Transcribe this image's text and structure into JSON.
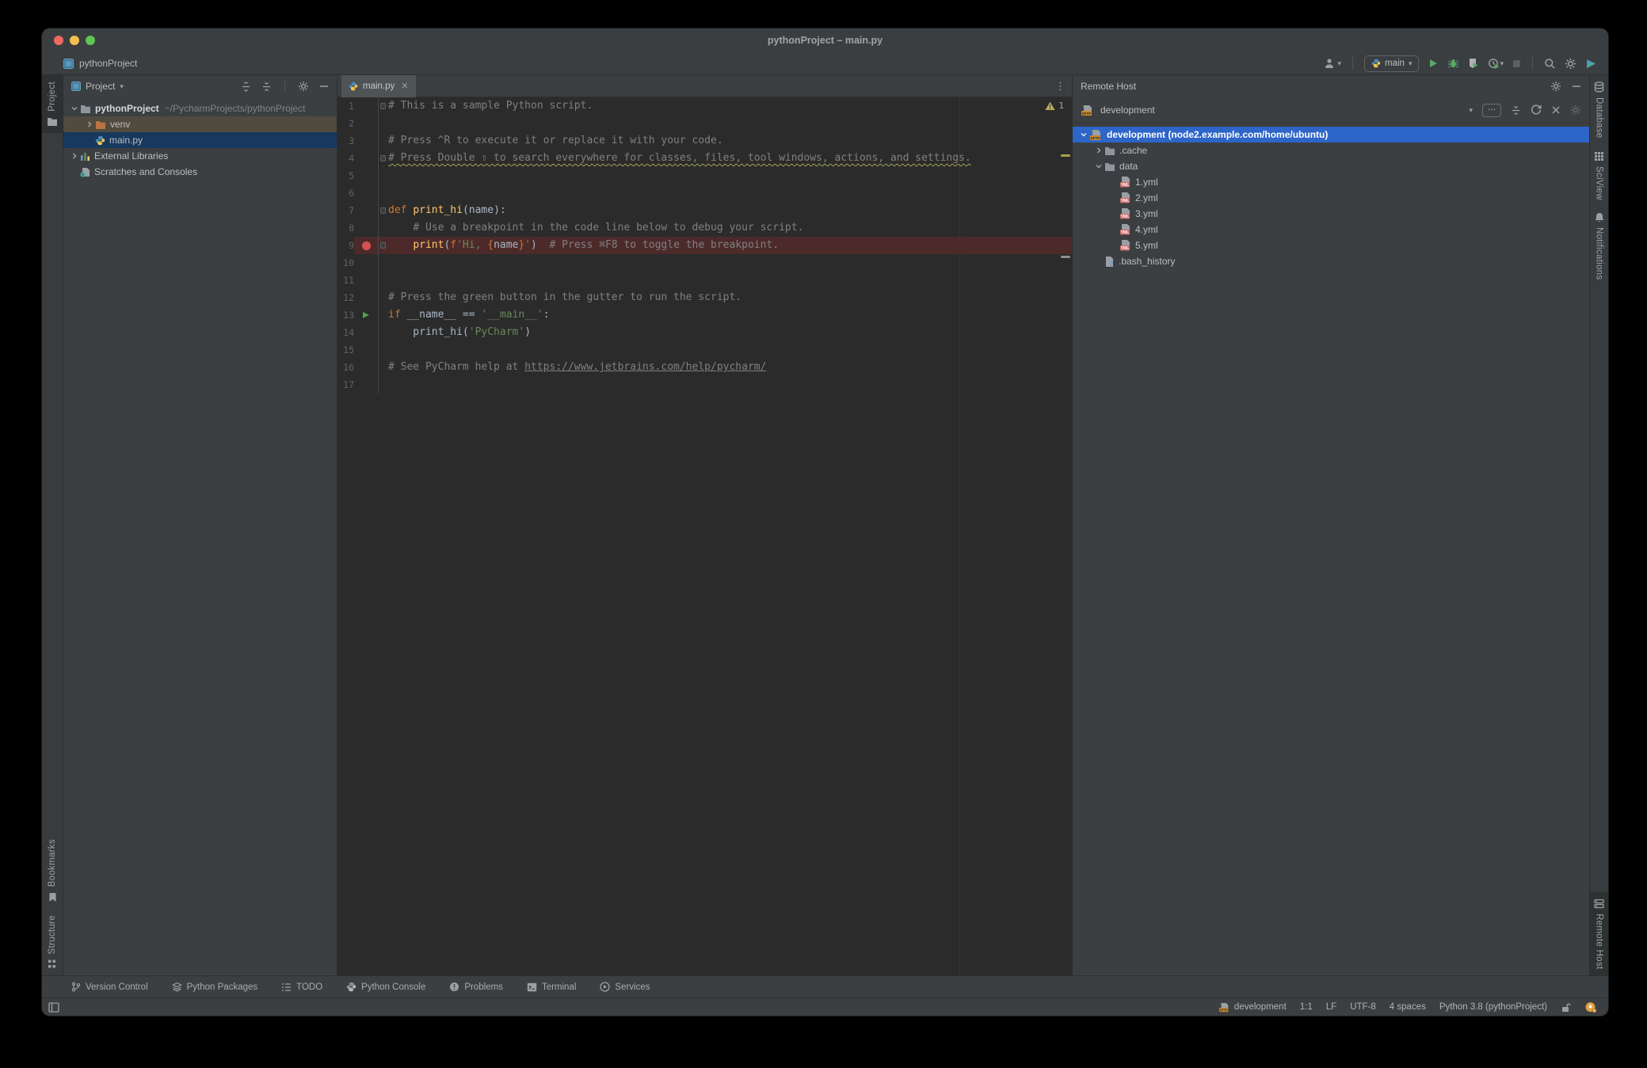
{
  "window": {
    "title": "pythonProject – main.py"
  },
  "header": {
    "breadcrumb": "pythonProject",
    "run_config": "main"
  },
  "activity_bars": {
    "left_top": [
      {
        "id": "project",
        "label": "Project",
        "icon": "tool-folder",
        "active": true
      }
    ],
    "left_bottom": [
      {
        "id": "bookmarks",
        "label": "Bookmarks",
        "icon": "bookmark"
      },
      {
        "id": "structure",
        "label": "Structure",
        "icon": "structure"
      }
    ],
    "right_top": [
      {
        "id": "database",
        "label": "Database",
        "icon": "database"
      },
      {
        "id": "sciview",
        "label": "SciView",
        "icon": "sciview"
      },
      {
        "id": "notifications",
        "label": "Notifications",
        "icon": "bell"
      }
    ],
    "right_bottom": [
      {
        "id": "remote-host",
        "label": "Remote Host",
        "icon": "server",
        "active": true
      }
    ]
  },
  "project_panel": {
    "title": "Project",
    "tree": [
      {
        "label": "pythonProject",
        "suffix": "~/PycharmProjects/pythonProject",
        "icon": "folder",
        "chevron": "down",
        "level": 0,
        "bold": true,
        "bg": "none"
      },
      {
        "label": "venv",
        "icon": "folder-excluded",
        "chevron": "right",
        "level": 1,
        "bg": "hover"
      },
      {
        "label": "main.py",
        "icon": "python-file",
        "chevron": "none",
        "level": 1,
        "bg": "selnav"
      },
      {
        "label": "External Libraries",
        "icon": "libraries",
        "chevron": "right",
        "level": 0,
        "bg": "none"
      },
      {
        "label": "Scratches and Consoles",
        "icon": "scratches",
        "chevron": "none",
        "level": 0,
        "bg": "none"
      }
    ]
  },
  "editor": {
    "tab": "main.py",
    "warning_badge": "1",
    "lines": [
      {
        "n": "1",
        "fold": true,
        "segs": [
          {
            "t": "# This is a sample Python script.",
            "c": "com"
          }
        ]
      },
      {
        "n": "2",
        "segs": []
      },
      {
        "n": "3",
        "segs": [
          {
            "t": "# Press ^R to execute it or replace it with your code.",
            "c": "com"
          }
        ]
      },
      {
        "n": "4",
        "fold": true,
        "segs": [
          {
            "t": "# Press Double ⇧ to search everywhere for classes, files, tool windows, actions, and settings.",
            "c": "com wavy"
          }
        ]
      },
      {
        "n": "5",
        "segs": []
      },
      {
        "n": "6",
        "segs": []
      },
      {
        "n": "7",
        "fold": true,
        "segs": [
          {
            "t": "def ",
            "c": "kw"
          },
          {
            "t": "print_hi",
            "c": "fn"
          },
          {
            "t": "(name):",
            "c": "pl"
          }
        ]
      },
      {
        "n": "8",
        "segs": [
          {
            "t": "    ",
            "c": "pl"
          },
          {
            "t": "# Use a breakpoint in the code line below to debug your script.",
            "c": "com"
          }
        ]
      },
      {
        "n": "9",
        "breakpoint": true,
        "fold": true,
        "highlight": true,
        "segs": [
          {
            "t": "    ",
            "c": "pl"
          },
          {
            "t": "print",
            "c": "fn"
          },
          {
            "t": "(",
            "c": "pl"
          },
          {
            "t": "f",
            "c": "kw"
          },
          {
            "t": "'Hi, ",
            "c": "str"
          },
          {
            "t": "{",
            "c": "kw"
          },
          {
            "t": "name",
            "c": "pl"
          },
          {
            "t": "}",
            "c": "kw"
          },
          {
            "t": "'",
            "c": "str"
          },
          {
            "t": ")",
            "c": "pl"
          },
          {
            "t": "  ",
            "c": "pl"
          },
          {
            "t": "# Press ⌘F8 to toggle the breakpoint.",
            "c": "com"
          }
        ]
      },
      {
        "n": "10",
        "segs": []
      },
      {
        "n": "11",
        "segs": []
      },
      {
        "n": "12",
        "segs": [
          {
            "t": "# Press the green button in the gutter to run the script.",
            "c": "com"
          }
        ]
      },
      {
        "n": "13",
        "run": true,
        "segs": [
          {
            "t": "if ",
            "c": "kw"
          },
          {
            "t": "__name__ == ",
            "c": "pl"
          },
          {
            "t": "'__main__'",
            "c": "str"
          },
          {
            "t": ":",
            "c": "pl"
          }
        ]
      },
      {
        "n": "14",
        "segs": [
          {
            "t": "    print_hi(",
            "c": "pl"
          },
          {
            "t": "'PyCharm'",
            "c": "str"
          },
          {
            "t": ")",
            "c": "pl"
          }
        ]
      },
      {
        "n": "15",
        "segs": []
      },
      {
        "n": "16",
        "segs": [
          {
            "t": "# See PyCharm help at ",
            "c": "com"
          },
          {
            "t": "https://www.jetbrains.com/help/pycharm/",
            "c": "com link"
          }
        ]
      },
      {
        "n": "17",
        "segs": []
      }
    ]
  },
  "remote_panel": {
    "title": "Remote Host",
    "server_name": "development",
    "dots_label": "…",
    "tree": [
      {
        "label": "development (node2.example.com/home/ubuntu)",
        "icon": "sftp",
        "chevron": "down",
        "level": 0,
        "bg": "sel"
      },
      {
        "label": ".cache",
        "icon": "folder",
        "chevron": "right",
        "level": 1,
        "bg": "none"
      },
      {
        "label": "data",
        "icon": "folder",
        "chevron": "down",
        "level": 1,
        "bg": "none"
      },
      {
        "label": "1.yml",
        "icon": "yml",
        "chevron": "none",
        "level": 2,
        "bg": "none"
      },
      {
        "label": "2.yml",
        "icon": "yml",
        "chevron": "none",
        "level": 2,
        "bg": "none"
      },
      {
        "label": "3.yml",
        "icon": "yml",
        "chevron": "none",
        "level": 2,
        "bg": "none"
      },
      {
        "label": "4.yml",
        "icon": "yml",
        "chevron": "none",
        "level": 2,
        "bg": "none"
      },
      {
        "label": "5.yml",
        "icon": "yml",
        "chevron": "none",
        "level": 2,
        "bg": "none"
      },
      {
        "label": ".bash_history",
        "icon": "file-unknown",
        "chevron": "none",
        "level": 1,
        "bg": "none"
      }
    ]
  },
  "bottom_bar": {
    "items": [
      {
        "label": "Version Control",
        "icon": "branch"
      },
      {
        "label": "Python Packages",
        "icon": "packages"
      },
      {
        "label": "TODO",
        "icon": "todo"
      },
      {
        "label": "Python Console",
        "icon": "python-console"
      },
      {
        "label": "Problems",
        "icon": "problems"
      },
      {
        "label": "Terminal",
        "icon": "terminal"
      },
      {
        "label": "Services",
        "icon": "services"
      }
    ]
  },
  "status_bar": {
    "host": "development",
    "caret": "1:1",
    "line_sep": "LF",
    "encoding": "UTF-8",
    "indent": "4 spaces",
    "interpreter": "Python 3.8 (pythonProject)"
  },
  "accents": {
    "selection_blue": "#2d65c8",
    "selection_inactive": "#17395d",
    "breakpoint_line": "#4d2a2a",
    "breakpoint_dot": "#d25252",
    "run_green": "#59a869",
    "editor_bg": "#2b2b2b",
    "panel_bg": "#3c3f41",
    "warning_yellow": "#b8ab5c"
  }
}
